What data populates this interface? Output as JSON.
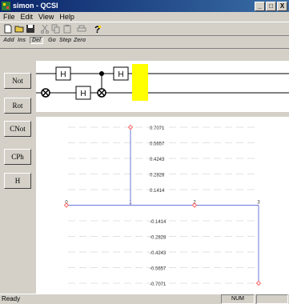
{
  "window": {
    "title": "simon - QCSI",
    "min_label": "_",
    "max_label": "□",
    "close_label": "X"
  },
  "menu": [
    "File",
    "Edit",
    "View",
    "Help"
  ],
  "toolbar2": {
    "add": "Add",
    "ins": "Ins",
    "del": "Del",
    "go": "Go",
    "step": "Step",
    "zero": "Zero"
  },
  "gate_buttons": [
    "Not",
    "Rot",
    "CNot",
    "CPh",
    "H"
  ],
  "circuit": {
    "gate_label": "H"
  },
  "chart_data": {
    "type": "line",
    "x_ticks": [
      "0",
      "1",
      "2",
      "3"
    ],
    "y_ticks": [
      0.7071,
      0.5657,
      0.4243,
      0.2828,
      0.1414,
      -0.1414,
      -0.2828,
      -0.4243,
      -0.5657,
      -0.7071
    ],
    "ylim": [
      -0.7071,
      0.7071
    ],
    "xlim": [
      0,
      3
    ],
    "series": [
      {
        "x": [
          0,
          1,
          2,
          3
        ],
        "values": [
          0,
          0.7071,
          0,
          -0.7071
        ]
      }
    ],
    "grid": true,
    "line_color": "#6a78d8",
    "marker_color": "#ff4040"
  },
  "status": {
    "ready": "Ready",
    "num": "NUM"
  }
}
